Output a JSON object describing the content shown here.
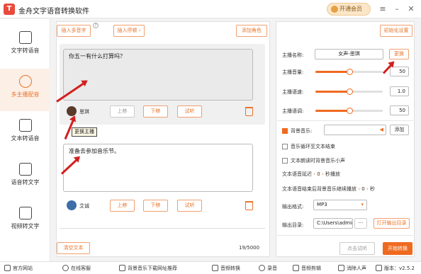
{
  "app": {
    "logo": "T",
    "title": "金舟文字语音转换软件",
    "vip_label": "开通会员"
  },
  "sidebar": {
    "items": [
      {
        "label": "文字转语音"
      },
      {
        "label": "多主播配音"
      },
      {
        "label": "文本转语音"
      },
      {
        "label": "语音转文字"
      },
      {
        "label": "视频转文字"
      }
    ]
  },
  "toolbar": {
    "insert_polyphone": "插入多音字",
    "help": "?",
    "insert_pause": "插入停顿 ›",
    "add_role": "添加角色"
  },
  "segments": [
    {
      "text": "你五一有什么打算吗？",
      "voice_name": "思琪",
      "up": "上移",
      "down": "下移",
      "listen": "试听"
    },
    {
      "text": "准备去参加音乐节。",
      "voice_name": "艾诚",
      "up": "上移",
      "down": "下移",
      "listen": "试听"
    }
  ],
  "tooltip": "更换主播",
  "bottom_mid": {
    "clear": "清空文本",
    "counter": "19/5000"
  },
  "settings": {
    "init_button": "初始化设置",
    "anchor_label": "主播名称:",
    "anchor_value": "女声-思琪",
    "change_button": "更换",
    "volume_label": "主播音量:",
    "volume_value": "50",
    "volume_level": 0.5,
    "speed_label": "主播语速:",
    "speed_value": "1.0",
    "speed_level": 0.5,
    "pitch_label": "主播语调:",
    "pitch_value": "50",
    "pitch_level": 0.5,
    "bgm_label": "背景音乐:",
    "bgm_add": "添加",
    "loop_label": "音乐循环至文本结束",
    "lower_label": "文本朗读时背景音乐小声",
    "delay_label": "文本语音延迟",
    "delay_value": "0",
    "delay_unit": "秒播放",
    "continue_label": "文本语音结束后背景音乐继续播放",
    "continue_value": "0",
    "continue_unit": "秒",
    "format_label": "输出格式:",
    "format_value": "MP3",
    "dir_label": "输出目录:",
    "dir_value": "C:\\Users\\admir",
    "dir_more": "···",
    "open_dir": "打开输出目录",
    "preview_button": "点击试听",
    "start_button": "开始转换"
  },
  "bottombar": {
    "items": [
      {
        "label": "官方网站"
      },
      {
        "label": "在线客服"
      },
      {
        "label": "背景音乐下载网址推荐"
      },
      {
        "label": "音频转换"
      },
      {
        "label": "录音"
      },
      {
        "label": "音频剪辑"
      },
      {
        "label": "消除人声"
      }
    ],
    "version": "版本：v2.5.2"
  },
  "colors": {
    "accent": "#ef6a1f",
    "annotation": "#d21f1f"
  }
}
